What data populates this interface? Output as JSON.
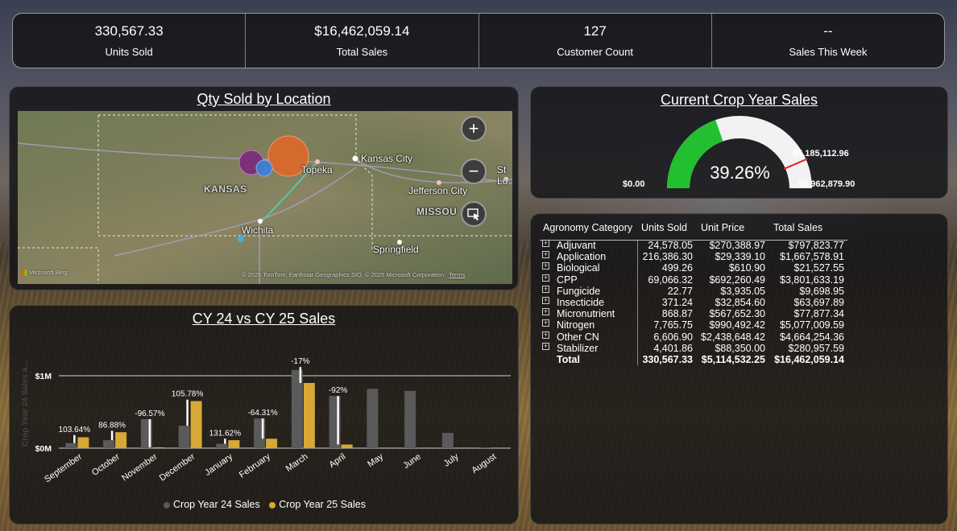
{
  "kpis": [
    {
      "value": "330,567.33",
      "label": "Units Sold"
    },
    {
      "value": "$16,462,059.14",
      "label": "Total Sales"
    },
    {
      "value": "127",
      "label": "Customer Count"
    },
    {
      "value": "--",
      "label": "Sales This Week"
    }
  ],
  "map": {
    "title": "Qty Sold by Location",
    "labels": {
      "kansas_city": "Kansas City",
      "topeka": "Topeka",
      "st_louis": "St Lo",
      "kansas": "KANSAS",
      "jefferson_city": "Jefferson City",
      "missouri": "MISSOU",
      "wichita": "Wichita",
      "springfield": "Springfield"
    },
    "attribution": "© 2025 TomTom, Earthstar Geographics SIO, © 2025 Microsoft Corporation",
    "terms": "Terms",
    "bing": "Microsoft Bing",
    "zoom_in": "+",
    "zoom_out": "−",
    "colors": {
      "orange": "#d9692b",
      "purple": "#7a2d7a",
      "blue": "#3f7fd4"
    }
  },
  "gauge": {
    "title": "Current Crop Year Sales",
    "percent": "39.26%",
    "min": "$0.00",
    "max": "$5,962,879.90",
    "target": "$5,185,112.96",
    "fill_fraction": 0.3926,
    "target_fraction": 0.8696,
    "fill_color": "#22c02f",
    "target_color": "#e0202a"
  },
  "table": {
    "headers": [
      "Agronomy Category",
      "Units Sold",
      "Unit Price",
      "Total Sales"
    ],
    "rows": [
      {
        "category": "Adjuvant",
        "units": "24,578.05",
        "price": "$270,388.97",
        "total": "$797,823.77"
      },
      {
        "category": "Application",
        "units": "216,386.30",
        "price": "$29,339.10",
        "total": "$1,667,578.91"
      },
      {
        "category": "Biological",
        "units": "499.26",
        "price": "$610.90",
        "total": "$21,527.55"
      },
      {
        "category": "CPP",
        "units": "69,066.32",
        "price": "$692,260.49",
        "total": "$3,801,633.19"
      },
      {
        "category": "Fungicide",
        "units": "22.77",
        "price": "$3,935.05",
        "total": "$9,698.95"
      },
      {
        "category": "Insecticide",
        "units": "371.24",
        "price": "$32,854.60",
        "total": "$63,697.89"
      },
      {
        "category": "Micronutrient",
        "units": "868.87",
        "price": "$567,652.30",
        "total": "$77,877.34"
      },
      {
        "category": "Nitrogen",
        "units": "7,765.75",
        "price": "$990,492.42",
        "total": "$5,077,009.59"
      },
      {
        "category": "Other CN",
        "units": "6,606.90",
        "price": "$2,438,648.42",
        "total": "$4,664,254.36"
      },
      {
        "category": "Stabilizer",
        "units": "4,401.86",
        "price": "$88,350.00",
        "total": "$280,957.59"
      }
    ],
    "total": {
      "category": "Total",
      "units": "330,567.33",
      "price": "$5,114,532.25",
      "total": "$16,462,059.14"
    },
    "expand_glyph": "+"
  },
  "chart_data": {
    "type": "bar",
    "title": "CY 24 vs CY 25 Sales",
    "ylabel": "Crop Year 24 Sales a...",
    "yticks": [
      "$0M",
      "$1M"
    ],
    "ylim": [
      0,
      1.1
    ],
    "categories": [
      "September",
      "October",
      "November",
      "December",
      "January",
      "February",
      "March",
      "April",
      "May",
      "June",
      "July",
      "August"
    ],
    "series": [
      {
        "name": "Crop Year 24 Sales",
        "color": "#5a5a5a",
        "values": [
          0.07,
          0.11,
          0.4,
          0.31,
          0.06,
          0.41,
          1.08,
          0.72,
          0.82,
          0.79,
          0.21,
          0.01
        ]
      },
      {
        "name": "Crop Year 25 Sales",
        "color": "#d7a833",
        "values": [
          0.15,
          0.22,
          0.01,
          0.65,
          0.11,
          0.13,
          0.9,
          0.05,
          0,
          0,
          0,
          0
        ]
      }
    ],
    "change_labels": [
      "103.64%",
      "86.88%",
      "-96.57%",
      "105.78%",
      "131.62%",
      "-64.31%",
      "-17%",
      "-92%",
      "",
      "",
      "",
      ""
    ],
    "error_bars": [
      [
        0.07,
        0.18
      ],
      [
        0.11,
        0.24
      ],
      [
        0.01,
        0.4
      ],
      [
        0.31,
        0.67
      ],
      [
        0.06,
        0.13
      ],
      [
        0.13,
        0.41
      ],
      [
        0.9,
        1.12
      ],
      [
        0.05,
        0.72
      ],
      null,
      null,
      null,
      null
    ]
  }
}
